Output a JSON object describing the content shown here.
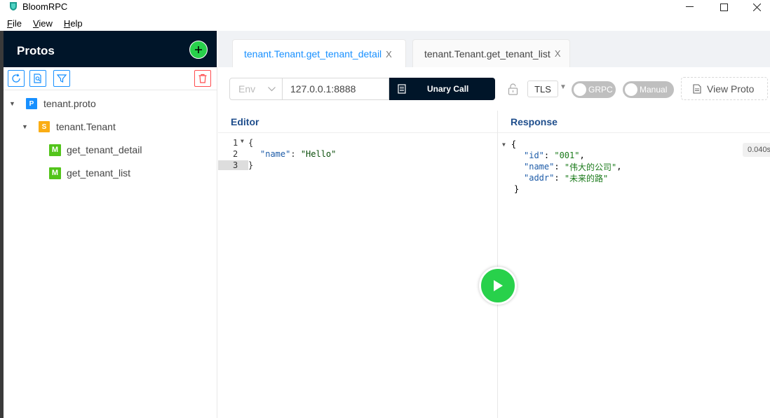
{
  "window": {
    "title": "BloomRPC",
    "minimize": "—",
    "maximize": "☐",
    "close": "✕"
  },
  "menu": [
    {
      "first": "F",
      "rest": "ile"
    },
    {
      "first": "V",
      "rest": "iew"
    },
    {
      "first": "H",
      "rest": "elp"
    }
  ],
  "sidebar": {
    "title": "Protos",
    "tree": {
      "proto": {
        "badge": "P",
        "label": "tenant.proto"
      },
      "service": {
        "badge": "S",
        "label": "tenant.Tenant"
      },
      "methods": [
        {
          "badge": "M",
          "label": "get_tenant_detail"
        },
        {
          "badge": "M",
          "label": "get_tenant_list"
        }
      ]
    }
  },
  "tabs": [
    {
      "label": "tenant.Tenant.get_tenant_detail",
      "close": "X",
      "active": true
    },
    {
      "label": "tenant.Tenant.get_tenant_list",
      "close": "X",
      "active": false
    }
  ],
  "controls": {
    "env_placeholder": "Env",
    "address": "127.0.0.1:8888",
    "call_type": "Unary Call",
    "tls": "TLS",
    "grpc_toggle": "GRPC",
    "manual_toggle": "Manual",
    "view_proto": "View Proto"
  },
  "editor": {
    "title": "Editor",
    "lines": [
      {
        "num": "1",
        "open": "{"
      },
      {
        "num": "2",
        "key": "\"name\"",
        "sep": ": ",
        "value": "\"Hello\""
      },
      {
        "num": "3",
        "close": "}"
      }
    ]
  },
  "response": {
    "title": "Response",
    "time": "0.040s",
    "open": "{",
    "close": "}",
    "fields": [
      {
        "key": "\"id\"",
        "sep": ": ",
        "value": "\"001\"",
        "comma": ","
      },
      {
        "key": "\"name\"",
        "sep": ": ",
        "value": "\"伟大的公司\"",
        "comma": ","
      },
      {
        "key": "\"addr\"",
        "sep": ": ",
        "value": "\"未来的路\"",
        "comma": ""
      }
    ]
  },
  "colors": {
    "sidebar_header": "#001529",
    "accent": "#1890ff",
    "play": "#28d14b"
  }
}
